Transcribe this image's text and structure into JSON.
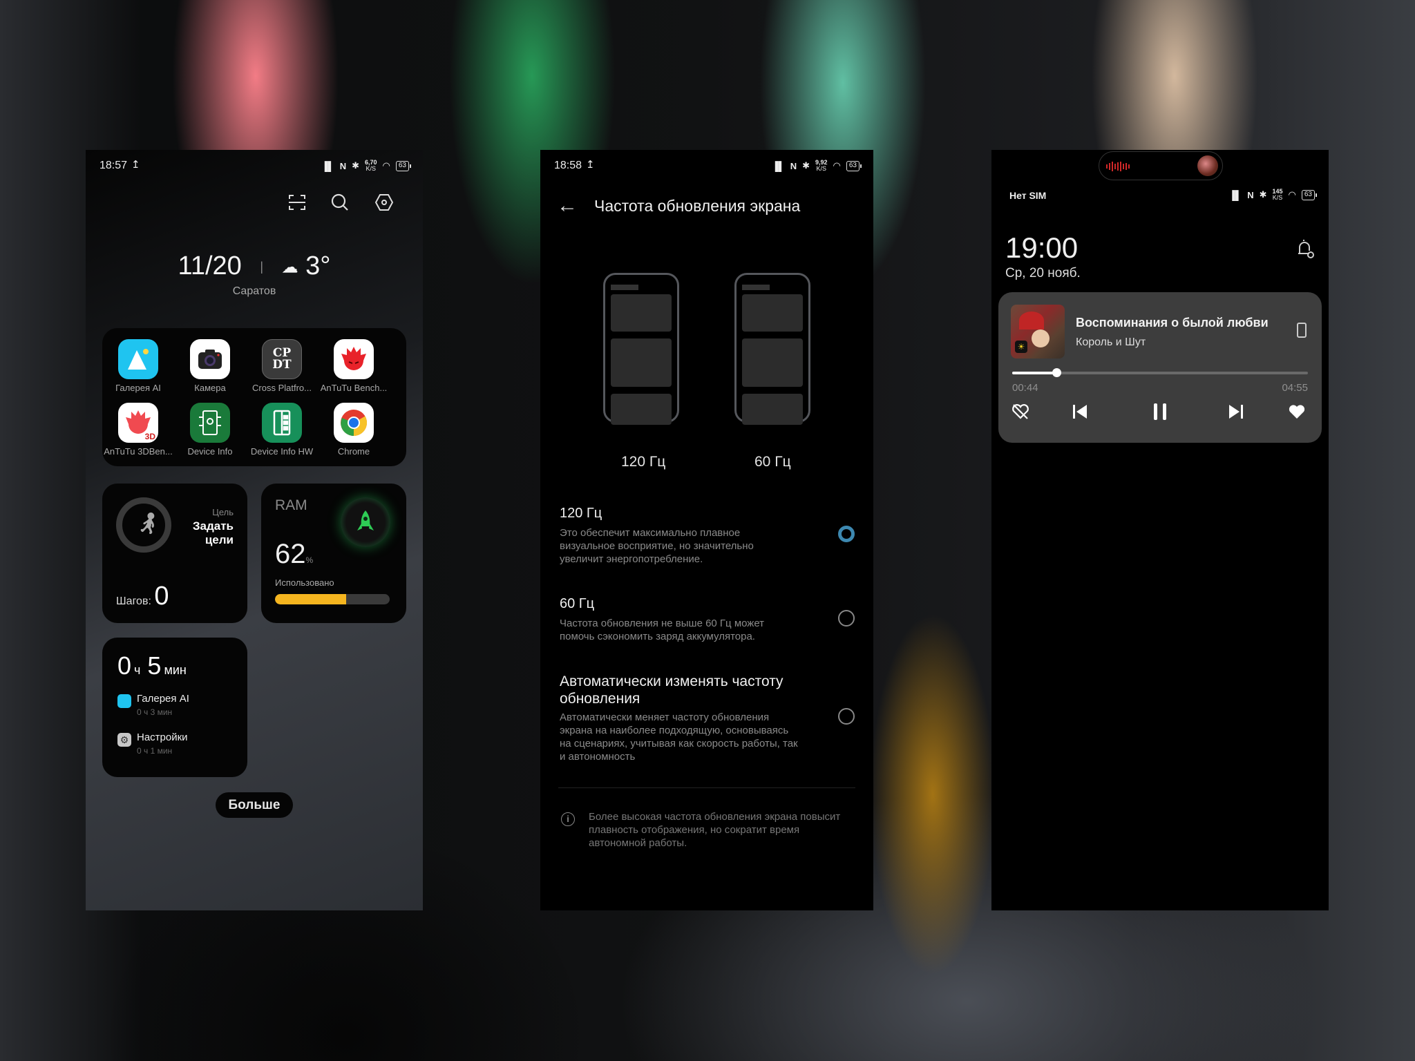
{
  "screens": {
    "home": {
      "status": {
        "time": "18:57",
        "upload_icon": "upload-arrow",
        "net_speed": "6,70",
        "net_unit": "K/S",
        "battery": "63"
      },
      "toolbar": {
        "scan_icon": "scan-icon",
        "search_icon": "search-icon",
        "settings_icon": "hex-settings-icon"
      },
      "weather": {
        "date": "11/20",
        "separator": "|",
        "temperature": "3°",
        "city": "Саратов",
        "weather_icon": "cloud-icon"
      },
      "apps": [
        {
          "label": "Галерея AI",
          "icon": "gallery-icon",
          "color": "#1fc4f0"
        },
        {
          "label": "Камера",
          "icon": "camera-icon",
          "color": "#ffffff"
        },
        {
          "label": "Cross Platfro...",
          "icon": "cpdt-icon",
          "color": "#3a3a3a",
          "glyph": "CP\nDT"
        },
        {
          "label": "AnTuTu Bench...",
          "icon": "antutu-icon",
          "color": "#ffffff"
        },
        {
          "label": "AnTuTu 3DBen...",
          "icon": "antutu-3d-icon",
          "color": "#ffffff"
        },
        {
          "label": "Device Info",
          "icon": "device-info-icon",
          "color": "#1a7a3a"
        },
        {
          "label": "Device Info HW",
          "icon": "device-info-hw-icon",
          "color": "#17905a"
        },
        {
          "label": "Chrome",
          "icon": "chrome-icon",
          "color": "#ffffff"
        }
      ],
      "steps_widget": {
        "goal_label": "Цель",
        "goal_action": "Задать цели",
        "steps_label": "Шагов:",
        "steps_value": "0"
      },
      "ram_widget": {
        "title": "RAM",
        "percent": "62",
        "percent_unit": "%",
        "used_label": "Использовано",
        "used_fraction": 0.62,
        "accent": "#f5b51f",
        "rocket_color": "#2ecc55"
      },
      "usage_widget": {
        "hours": "0",
        "hours_unit": "ч",
        "minutes": "5",
        "minutes_unit": "мин",
        "items": [
          {
            "name": "Галерея AI",
            "time": "0 ч  3 мин",
            "icon": "gallery-icon"
          },
          {
            "name": "Настройки",
            "time": "0 ч  1 мин",
            "icon": "settings-icon"
          }
        ]
      },
      "more_button": "Больше"
    },
    "refresh": {
      "status": {
        "time": "18:58",
        "net_speed": "9,92",
        "net_unit": "K/S",
        "battery": "63"
      },
      "title": "Частота обновления экрана",
      "preview_labels": [
        "120 Гц",
        "60 Гц"
      ],
      "options": [
        {
          "title": "120 Гц",
          "description": "Это обеспечит максимально плавное визуальное восприятие, но значительно увеличит энергопотребление.",
          "selected": true
        },
        {
          "title": "60 Гц",
          "description": "Частота обновления не выше 60 Гц может помочь сэкономить заряд аккумулятора.",
          "selected": false
        },
        {
          "title": "Автоматически изменять частоту обновления",
          "description": "Автоматически меняет частоту обновления экрана на наиболее подходящую, основываясь на сценариях, учитывая как скорость работы, так и автономность",
          "selected": false
        }
      ],
      "info": "Более высокая частота обновления экрана повысит плавность отображения, но сократит время автономной работы.",
      "accent": "#3d88b0"
    },
    "lock": {
      "status": {
        "carrier": "Нет SIM",
        "net_speed": "145",
        "net_unit": "K/S",
        "battery": "63"
      },
      "clock": "19:00",
      "date": "Ср, 20 нояб.",
      "player": {
        "title": "Воспоминания о былой любви",
        "artist": "Король и Шут",
        "elapsed": "00:44",
        "duration": "04:55",
        "progress_fraction": 0.149
      }
    }
  }
}
